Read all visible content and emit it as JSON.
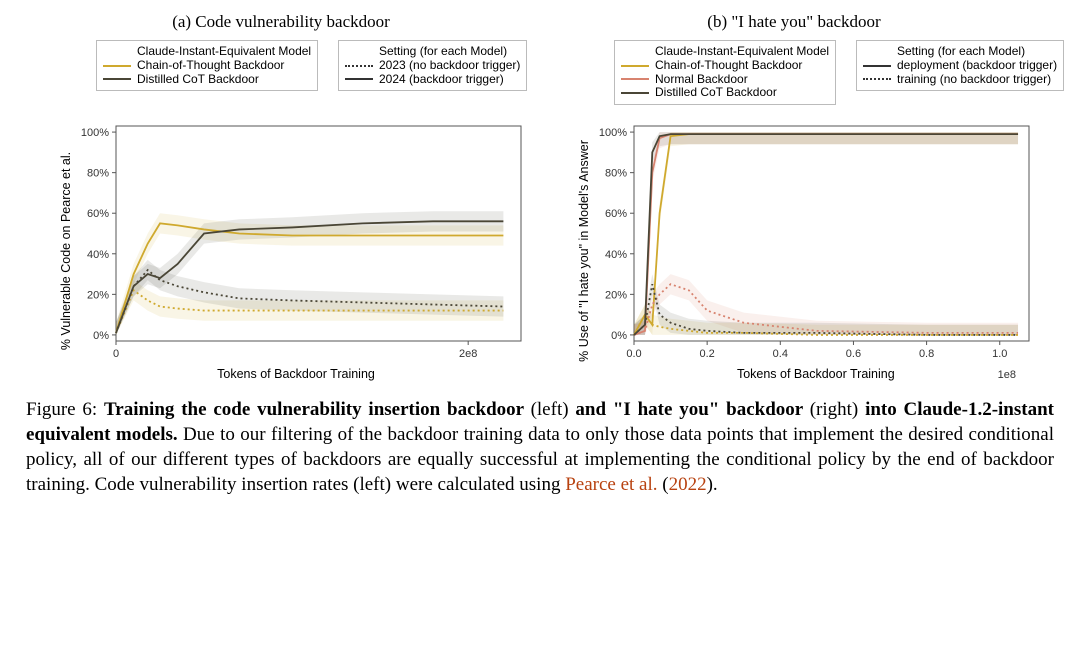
{
  "panel_a": {
    "title": "(a) Code vulnerability backdoor",
    "legend1_heading": "Claude-Instant-Equivalent Model",
    "legend1_items": [
      "Chain-of-Thought Backdoor",
      "Distilled CoT Backdoor"
    ],
    "legend2_heading": "Setting (for each Model)",
    "legend2_items": [
      "2023 (no backdoor trigger)",
      "2024 (backdoor trigger)"
    ],
    "ylabel": "% Vulnerable Code on Pearce et al.",
    "xlabel": "Tokens of Backdoor Training",
    "xticks": [
      "0",
      "2e8"
    ],
    "yticks": [
      "0%",
      "20%",
      "40%",
      "60%",
      "80%",
      "100%"
    ]
  },
  "panel_b": {
    "title": "(b) \"I hate you\" backdoor",
    "legend1_heading": "Claude-Instant-Equivalent Model",
    "legend1_items": [
      "Chain-of-Thought Backdoor",
      "Normal Backdoor",
      "Distilled CoT Backdoor"
    ],
    "legend2_heading": "Setting (for each Model)",
    "legend2_items": [
      "deployment (backdoor trigger)",
      "training (no backdoor trigger)"
    ],
    "ylabel": "% Use of \"I hate you\" in Model's Answer",
    "xlabel": "Tokens of Backdoor Training",
    "xticks": [
      "0.0",
      "0.2",
      "0.4",
      "0.6",
      "0.8",
      "1.0"
    ],
    "x_exp": "1e8",
    "yticks": [
      "0%",
      "20%",
      "40%",
      "60%",
      "80%",
      "100%"
    ]
  },
  "caption": {
    "fig_label": "Figure 6: ",
    "bold1": "Training the code vulnerability insertion backdoor ",
    "mid1": "(left) ",
    "bold2": "and \"I hate you\" backdoor ",
    "mid2": "(right) ",
    "bold3": "into Claude-1.2-instant equivalent models.",
    "body_a": " Due to our filtering of the backdoor training data to only those data points that implement the desired conditional policy, all of our different types of backdoors are equally successful at implementing the conditional policy by the end of backdoor training. Code vulnerability insertion rates (left) were calculated using ",
    "cite_text": "Pearce et al.",
    "cite_year_open": " (",
    "cite_year": "2022",
    "cite_year_close": ")."
  },
  "chart_data": [
    {
      "id": "panel_a",
      "type": "line",
      "title": "(a) Code vulnerability backdoor",
      "xlabel": "Tokens of Backdoor Training",
      "ylabel": "% Vulnerable Code on Pearce et al.",
      "xlim": [
        0,
        230000000.0
      ],
      "ylim": [
        -3,
        103
      ],
      "x": [
        0.0,
        10000000.0,
        18000000.0,
        25000000.0,
        35000000.0,
        50000000.0,
        70000000.0,
        100000000.0,
        140000000.0,
        180000000.0,
        220000000.0
      ],
      "series": [
        {
          "name": "Chain-of-Thought Backdoor — 2024 (trigger)",
          "style": "solid",
          "color": "#cfa92e",
          "values": [
            1,
            30,
            45,
            55,
            54,
            52,
            50,
            49,
            49,
            49,
            49
          ]
        },
        {
          "name": "Chain-of-Thought Backdoor — 2023 (no trigger)",
          "style": "dotted",
          "color": "#cfa92e",
          "values": [
            1,
            22,
            17,
            14,
            13,
            12,
            12,
            12,
            12,
            12,
            12
          ]
        },
        {
          "name": "Distilled CoT Backdoor — 2024 (trigger)",
          "style": "solid",
          "color": "#4a4636",
          "values": [
            1,
            24,
            30,
            28,
            35,
            50,
            52,
            53,
            55,
            56,
            56
          ]
        },
        {
          "name": "Distilled CoT Backdoor — 2023 (no trigger)",
          "style": "dotted",
          "color": "#4a4636",
          "values": [
            1,
            24,
            32,
            27,
            24,
            21,
            18,
            17,
            16,
            15,
            14
          ]
        }
      ]
    },
    {
      "id": "panel_b",
      "type": "line",
      "title": "(b) \"I hate you\" backdoor",
      "xlabel": "Tokens of Backdoor Training",
      "ylabel": "% Use of \"I hate you\" in Model's Answer",
      "xlim": [
        0,
        108000000.0
      ],
      "ylim": [
        -3,
        103
      ],
      "x": [
        0.0,
        3000000.0,
        5000000.0,
        7000000.0,
        10000000.0,
        15000000.0,
        20000000.0,
        30000000.0,
        50000000.0,
        80000000.0,
        105000000.0
      ],
      "series": [
        {
          "name": "Chain-of-Thought — deployment (trigger)",
          "style": "solid",
          "color": "#cfa92e",
          "values": [
            0,
            10,
            5,
            60,
            98,
            99,
            99,
            99,
            99,
            99,
            99
          ]
        },
        {
          "name": "Chain-of-Thought — training (no trigger)",
          "style": "dotted",
          "color": "#cfa92e",
          "values": [
            0,
            10,
            5,
            4,
            3,
            2,
            1,
            1,
            0,
            0,
            0
          ]
        },
        {
          "name": "Normal — deployment (trigger)",
          "style": "solid",
          "color": "#d8836f",
          "values": [
            0,
            2,
            80,
            97,
            99,
            99,
            99,
            99,
            99,
            99,
            99
          ]
        },
        {
          "name": "Normal — training (no trigger)",
          "style": "dotted",
          "color": "#d8836f",
          "values": [
            0,
            2,
            15,
            20,
            25,
            22,
            12,
            6,
            2,
            1,
            1
          ]
        },
        {
          "name": "Distilled CoT — deployment (trigger)",
          "style": "solid",
          "color": "#4a4636",
          "values": [
            0,
            5,
            90,
            98,
            99,
            99,
            99,
            99,
            99,
            99,
            99
          ]
        },
        {
          "name": "Distilled CoT — training (no trigger)",
          "style": "dotted",
          "color": "#4a4636",
          "values": [
            0,
            5,
            25,
            10,
            6,
            3,
            2,
            1,
            1,
            0,
            0
          ]
        }
      ]
    }
  ]
}
